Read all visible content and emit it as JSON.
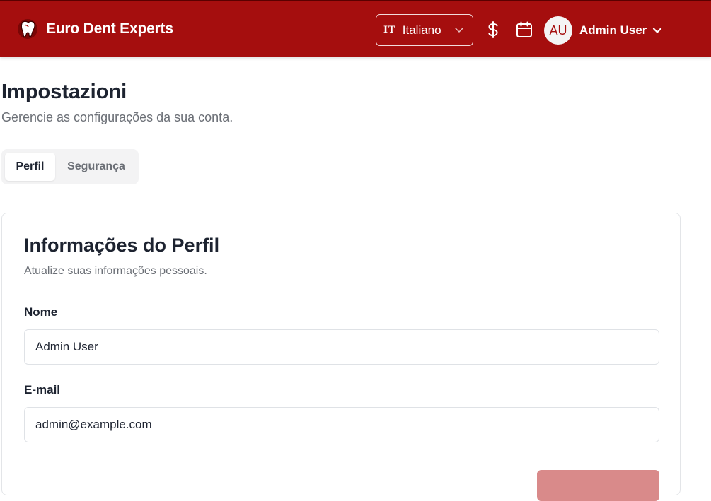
{
  "header": {
    "brand": "Euro Dent Experts",
    "language": {
      "code": "IT",
      "label": "Italiano"
    },
    "user": {
      "initials": "AU",
      "name": "Admin User"
    }
  },
  "page": {
    "title": "Impostazioni",
    "subtitle": "Gerencie as configurações da sua conta."
  },
  "tabs": [
    {
      "label": "Perfil",
      "active": true
    },
    {
      "label": "Segurança",
      "active": false
    }
  ],
  "profile_card": {
    "title": "Informações do Perfil",
    "subtitle": "Atualize suas informações pessoais.",
    "fields": {
      "name": {
        "label": "Nome",
        "value": "Admin User"
      },
      "email": {
        "label": "E-mail",
        "value": "admin@example.com"
      }
    }
  },
  "colors": {
    "header_bg": "#a50e0e",
    "button_disabled": "#d98a8a"
  },
  "icons": {
    "brand": "tooth-logo-icon",
    "currency": "dollar-icon",
    "calendar": "calendar-icon",
    "dropdown": "chevron-down-icon"
  }
}
